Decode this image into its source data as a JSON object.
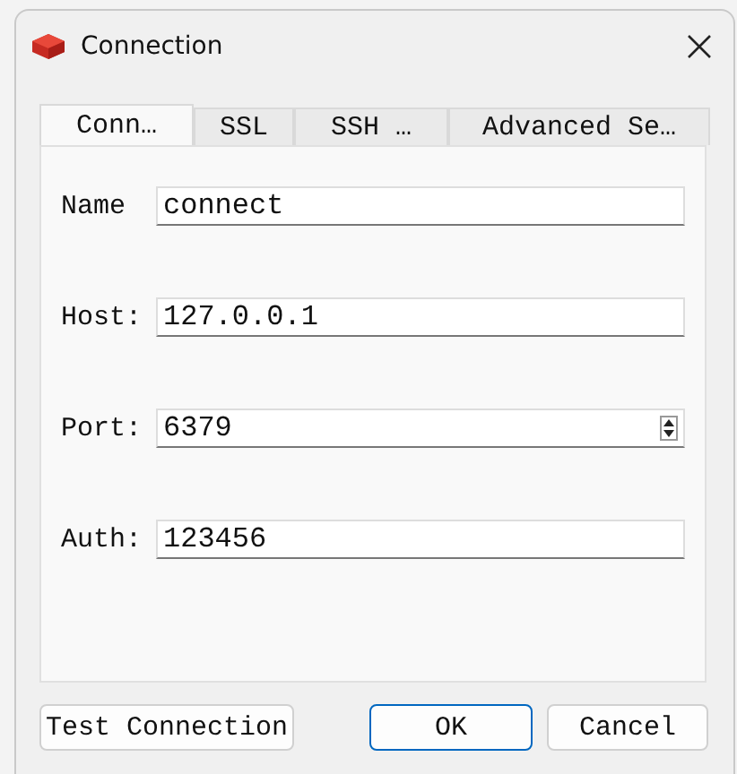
{
  "window": {
    "title": "Connection"
  },
  "tabs": [
    {
      "label": "Conn…",
      "selected": true
    },
    {
      "label": "SSL",
      "selected": false
    },
    {
      "label": "SSH …",
      "selected": false
    },
    {
      "label": "Advanced Se…",
      "selected": false
    }
  ],
  "fields": [
    {
      "label": "Name",
      "value": "connect",
      "kind": "text"
    },
    {
      "label": "Host:",
      "value": "127.0.0.1",
      "kind": "text"
    },
    {
      "label": "Port:",
      "value": "6379",
      "kind": "spin"
    },
    {
      "label": "Auth:",
      "value": "123456",
      "kind": "text"
    }
  ],
  "buttons": [
    {
      "label": "Test Connection",
      "kind": "normal"
    },
    {
      "label": "OK",
      "kind": "default"
    },
    {
      "label": "Cancel",
      "kind": "normal"
    }
  ]
}
